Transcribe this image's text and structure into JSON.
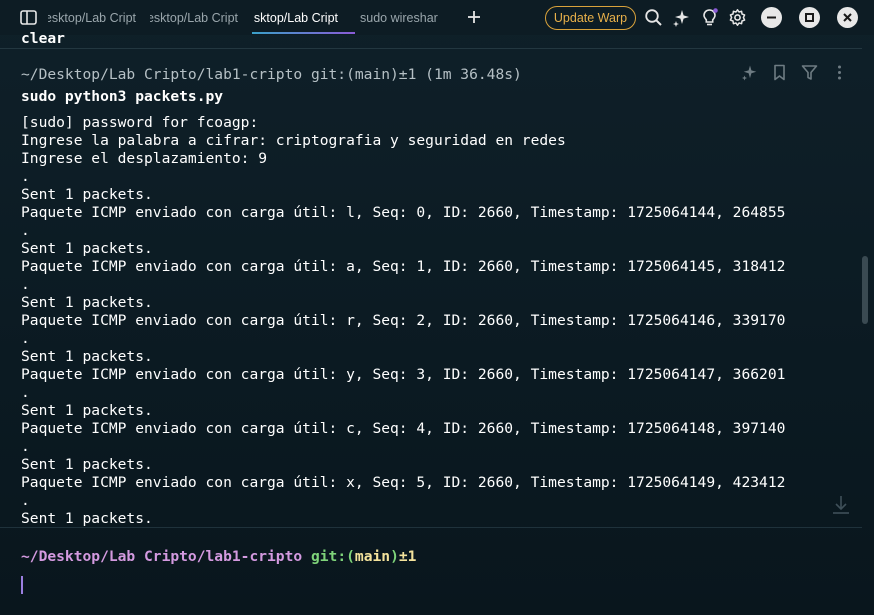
{
  "tabs": [
    {
      "label": "~/Desktop/Lab Cript",
      "active": false
    },
    {
      "label": "~/Desktop/Lab Cript",
      "active": false
    },
    {
      "label": "~/Desktop/Lab Cript",
      "active": true
    },
    {
      "label": "sudo wireshar",
      "active": false
    }
  ],
  "toolbar": {
    "update_label": "Update Warp"
  },
  "icons": {
    "panes": "split-panes-icon",
    "new_tab": "plus-icon",
    "search": "search-icon",
    "ai": "sparkle-icon",
    "tips": "lightbulb-icon",
    "settings": "gear-icon",
    "minimize": "minimize-icon",
    "maximize": "maximize-icon",
    "close": "close-icon"
  },
  "colors": {
    "accent_update": "#e8b04a",
    "prompt_path": "#d49ae0",
    "prompt_git": "#7fd47a",
    "prompt_branch": "#f4e39c",
    "cursor": "#9b7fe0"
  },
  "terminal": {
    "previous_command": "clear",
    "block": {
      "header": "~/Desktop/Lab Cripto/lab1-cripto git:(main)±1 (1m 36.48s)",
      "command": "sudo python3 packets.py",
      "output": [
        "[sudo] password for fcoagp:",
        "Ingrese la palabra a cifrar: criptografia y seguridad en redes",
        "Ingrese el desplazamiento: 9",
        ".",
        "Sent 1 packets.",
        "Paquete ICMP enviado con carga útil: l, Seq: 0, ID: 2660, Timestamp: 1725064144, 264855",
        ".",
        "Sent 1 packets.",
        "Paquete ICMP enviado con carga útil: a, Seq: 1, ID: 2660, Timestamp: 1725064145, 318412",
        ".",
        "Sent 1 packets.",
        "Paquete ICMP enviado con carga útil: r, Seq: 2, ID: 2660, Timestamp: 1725064146, 339170",
        ".",
        "Sent 1 packets.",
        "Paquete ICMP enviado con carga útil: y, Seq: 3, ID: 2660, Timestamp: 1725064147, 366201",
        ".",
        "Sent 1 packets.",
        "Paquete ICMP enviado con carga útil: c, Seq: 4, ID: 2660, Timestamp: 1725064148, 397140",
        ".",
        "Sent 1 packets.",
        "Paquete ICMP enviado con carga útil: x, Seq: 5, ID: 2660, Timestamp: 1725064149, 423412",
        ".",
        "Sent 1 packets."
      ]
    },
    "prompt": {
      "path": "~/Desktop/Lab Cripto/lab1-cripto",
      "git_label": "git:(",
      "branch": "main",
      "git_close": ")",
      "status": "±1"
    }
  }
}
